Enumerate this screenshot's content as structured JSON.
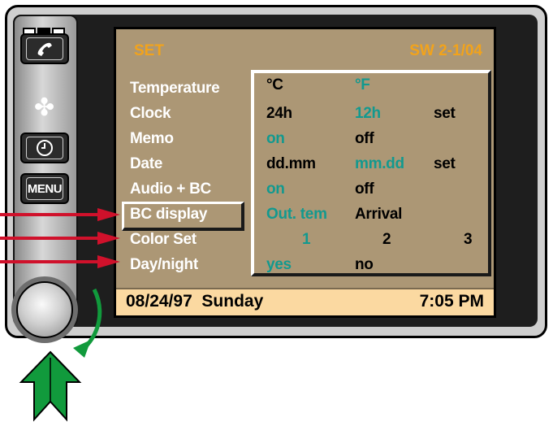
{
  "screen": {
    "title": "SET",
    "software_version": "SW 2-1/04"
  },
  "menu": {
    "items": [
      "Temperature",
      "Clock",
      "Memo",
      "Date",
      "Audio + BC",
      "BC display",
      "Color Set",
      "Day/night"
    ],
    "selected_index": 5
  },
  "options": {
    "temperature": [
      "°C",
      "°F"
    ],
    "clock": [
      "24h",
      "12h",
      "set"
    ],
    "memo": [
      "on",
      "off"
    ],
    "date": [
      "dd.mm",
      "mm.dd",
      "set"
    ],
    "audio_bc": [
      "on",
      "off"
    ],
    "bc_display": [
      "Out. tem",
      "Arrival"
    ],
    "color_set": [
      "1",
      "2",
      "3"
    ],
    "day_night": [
      "yes",
      "no"
    ]
  },
  "status_bar": {
    "date": "08/24/97",
    "day": "Sunday",
    "time": "7:05 PM"
  },
  "controls": {
    "menu_button_label": "MENU",
    "icons": [
      "phone-icon",
      "fan-icon",
      "clock-icon",
      "rotary-knob"
    ]
  },
  "colors": {
    "screen_background": "#ac9775",
    "title_orange": "#f2a31b",
    "option_active_teal": "#12998f",
    "status_bar_background": "#fbd9a1",
    "arrow_red": "#d0112b",
    "arrow_green": "#119a3c"
  }
}
